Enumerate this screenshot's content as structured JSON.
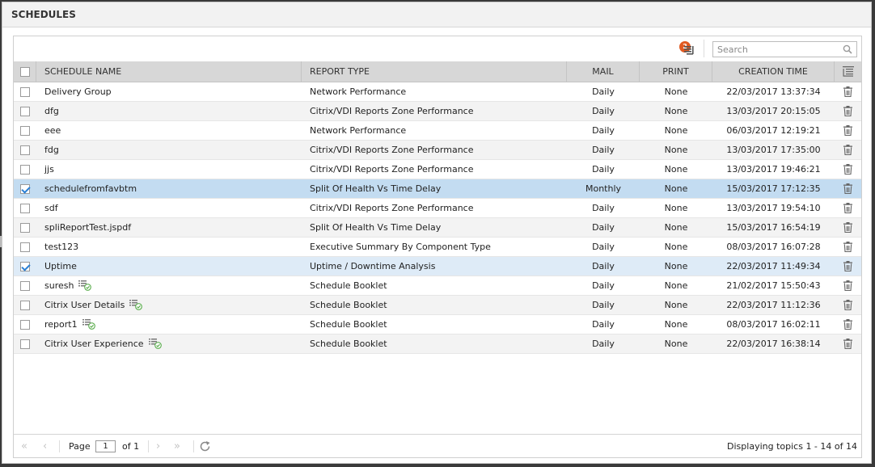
{
  "window": {
    "title": "SCHEDULES"
  },
  "toolbar": {
    "columns_badge": "2",
    "search_placeholder": "Search"
  },
  "columns": {
    "name": "SCHEDULE NAME",
    "type": "REPORT TYPE",
    "mail": "MAIL",
    "print": "PRINT",
    "time": "CREATION TIME"
  },
  "rows": [
    {
      "name": "Delivery Group",
      "type": "Network Performance",
      "mail": "Daily",
      "print": "None",
      "time": "22/03/2017 13:37:34",
      "checked": false,
      "booklet": false
    },
    {
      "name": "dfg",
      "type": "Citrix/VDI Reports Zone Performance",
      "mail": "Daily",
      "print": "None",
      "time": "13/03/2017 20:15:05",
      "checked": false,
      "booklet": false
    },
    {
      "name": "eee",
      "type": "Network Performance",
      "mail": "Daily",
      "print": "None",
      "time": "06/03/2017 12:19:21",
      "checked": false,
      "booklet": false
    },
    {
      "name": "fdg",
      "type": "Citrix/VDI Reports Zone Performance",
      "mail": "Daily",
      "print": "None",
      "time": "13/03/2017 17:35:00",
      "checked": false,
      "booklet": false
    },
    {
      "name": "jjs",
      "type": "Citrix/VDI Reports Zone Performance",
      "mail": "Daily",
      "print": "None",
      "time": "13/03/2017 19:46:21",
      "checked": false,
      "booklet": false
    },
    {
      "name": "schedulefromfavbtm",
      "type": "Split Of Health Vs Time Delay",
      "mail": "Monthly",
      "print": "None",
      "time": "15/03/2017 17:12:35",
      "checked": true,
      "booklet": false
    },
    {
      "name": "sdf",
      "type": "Citrix/VDI Reports Zone Performance",
      "mail": "Daily",
      "print": "None",
      "time": "13/03/2017 19:54:10",
      "checked": false,
      "booklet": false
    },
    {
      "name": "spliReportTest.jspdf",
      "type": "Split Of Health Vs Time Delay",
      "mail": "Daily",
      "print": "None",
      "time": "15/03/2017 16:54:19",
      "checked": false,
      "booklet": false
    },
    {
      "name": "test123",
      "type": "Executive Summary By Component Type",
      "mail": "Daily",
      "print": "None",
      "time": "08/03/2017 16:07:28",
      "checked": false,
      "booklet": false
    },
    {
      "name": "Uptime",
      "type": "Uptime / Downtime Analysis",
      "mail": "Daily",
      "print": "None",
      "time": "22/03/2017 11:49:34",
      "checked": true,
      "booklet": false
    },
    {
      "name": "suresh",
      "type": "Schedule Booklet",
      "mail": "Daily",
      "print": "None",
      "time": "21/02/2017 15:50:43",
      "checked": false,
      "booklet": true
    },
    {
      "name": "Citrix User Details",
      "type": "Schedule Booklet",
      "mail": "Daily",
      "print": "None",
      "time": "22/03/2017 11:12:36",
      "checked": false,
      "booklet": true
    },
    {
      "name": "report1",
      "type": "Schedule Booklet",
      "mail": "Daily",
      "print": "None",
      "time": "08/03/2017 16:02:11",
      "checked": false,
      "booklet": true
    },
    {
      "name": "Citrix User Experience",
      "type": "Schedule Booklet",
      "mail": "Daily",
      "print": "None",
      "time": "22/03/2017 16:38:14",
      "checked": false,
      "booklet": true
    }
  ],
  "pager": {
    "page_label": "Page",
    "page_value": "1",
    "of_label": "of 1",
    "status": "Displaying topics 1 - 14 of 14"
  },
  "colors": {
    "accent": "#2a7fd4",
    "badge": "#e05a22",
    "selected_row": "#c3dcf1",
    "checked_row": "#deebf7",
    "header": "#d7d7d7"
  }
}
